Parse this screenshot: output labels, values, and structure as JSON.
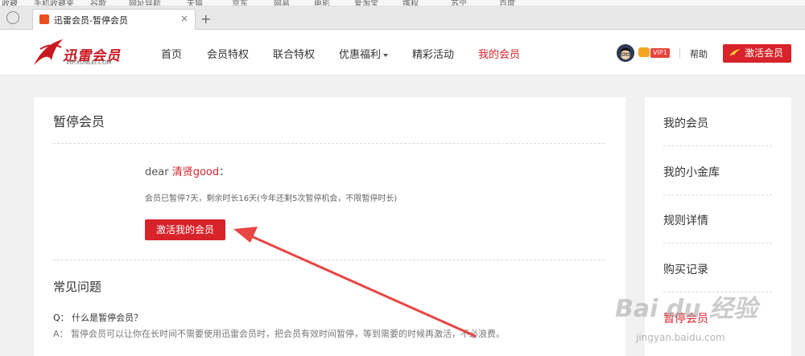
{
  "browser": {
    "bookmarks": [
      "收藏",
      "手机收藏夹",
      "谷歌",
      "网址导航",
      "天猫",
      "京东",
      "网易",
      "电影",
      "爱淘宝",
      "携程",
      "苏宁",
      "百度"
    ],
    "tab_title": "迅雷会员-暂停会员",
    "tab_close": "×",
    "new_tab": "+"
  },
  "header": {
    "logo_cn": "迅雷会员",
    "logo_en": "VIP.XUNLEI.COM",
    "nav": [
      "首页",
      "会员特权",
      "联合特权",
      "优惠福利",
      "精彩活动",
      "我的会员"
    ],
    "vip_badge": "VIP1",
    "help": "帮助",
    "activate": "激活会员"
  },
  "main": {
    "title": "暂停会员",
    "dear_prefix": "dear ",
    "user_name": "清贤good",
    "dear_suffix": "：",
    "status": "会员已暂停7天，剩余时长16天(今年还剩5次暂停机会，不限暂停时长)",
    "activate_button": "激活我的会员",
    "faq_title": "常见问题",
    "faq_q": "Q：  什么是暂停会员？",
    "faq_a": "A：  暂停会员可以让你在长时间不需要使用迅雷会员时，把会员有效时间暂停，等到需要的时候再激活，不必浪费。"
  },
  "sidebar": {
    "items": [
      "我的会员",
      "我的小金库",
      "规则详情",
      "购买记录",
      "暂停会员"
    ]
  },
  "watermark": {
    "main": "Bai du 经验",
    "sub": "jingyan.baidu.com"
  },
  "colors": {
    "accent": "#d8232a",
    "background": "#f1f1f1",
    "panel": "#ffffff"
  }
}
